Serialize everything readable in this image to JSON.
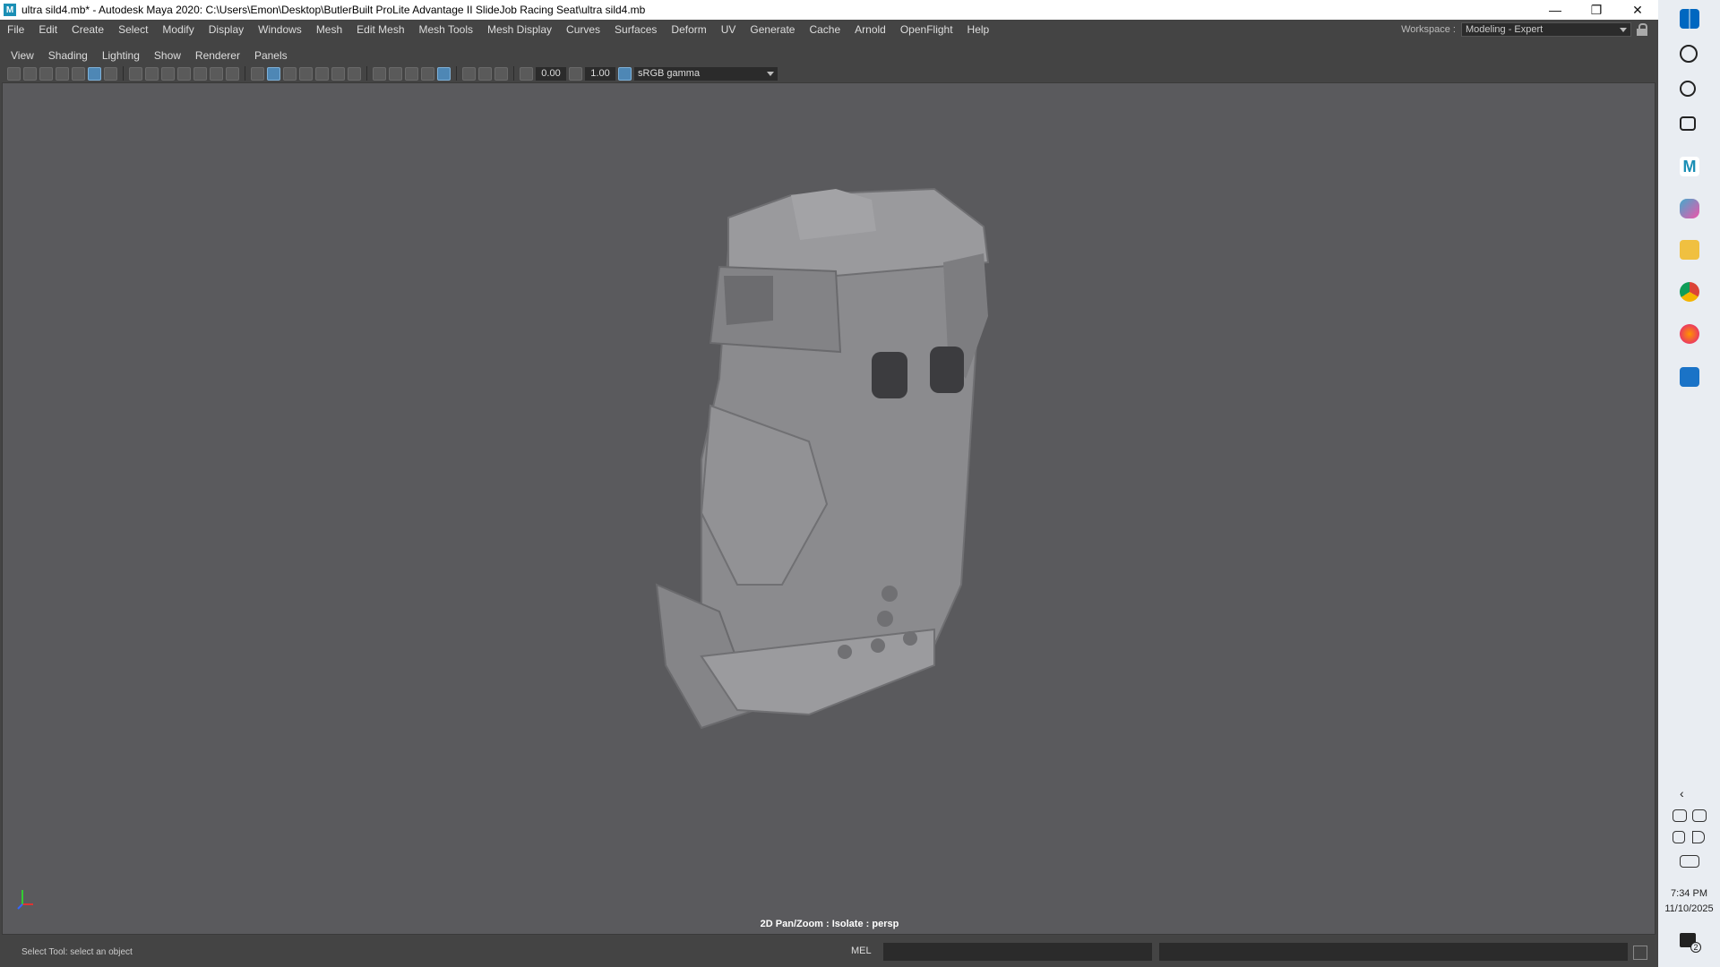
{
  "window": {
    "title": "ultra sild4.mb* - Autodesk Maya 2020: C:\\Users\\Emon\\Desktop\\ButlerBuilt ProLite Advantage II SlideJob Racing Seat\\ultra sild4.mb",
    "app_icon_letter": "M"
  },
  "menu": {
    "items": [
      "File",
      "Edit",
      "Create",
      "Select",
      "Modify",
      "Display",
      "Windows",
      "Mesh",
      "Edit Mesh",
      "Mesh Tools",
      "Mesh Display",
      "Curves",
      "Surfaces",
      "Deform",
      "UV",
      "Generate",
      "Cache",
      "Arnold",
      "OpenFlight",
      "Help"
    ],
    "workspace_label": "Workspace :",
    "workspace_value": "Modeling - Expert"
  },
  "panel_menu": [
    "View",
    "Shading",
    "Lighting",
    "Show",
    "Renderer",
    "Panels"
  ],
  "toolbar": {
    "exposure": "0.00",
    "gamma": "1.00",
    "color_space": "sRGB gamma"
  },
  "viewport": {
    "label": "2D Pan/Zoom : Isolate : persp"
  },
  "status": {
    "help_line": "Select Tool: select an object",
    "command_lang": "MEL"
  },
  "taskbar": {
    "time": "7:34 PM",
    "date": "11/10/2025",
    "notification_count": "2"
  }
}
